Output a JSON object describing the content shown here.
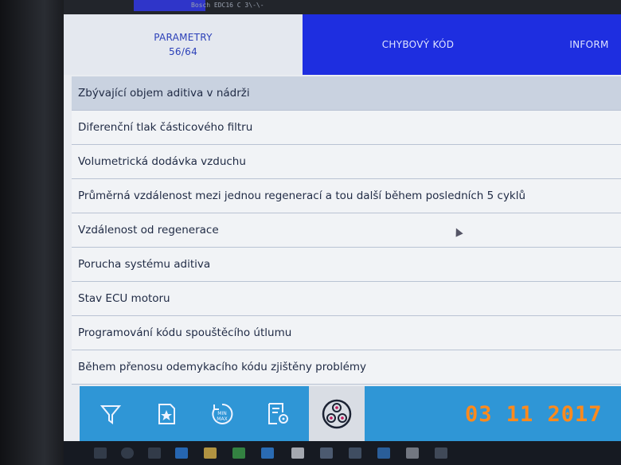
{
  "window": {
    "title": "Bosch EDC16 C 3\\-\\-"
  },
  "tabs": [
    {
      "label": "PARAMETRY",
      "count": "56/64"
    },
    {
      "label": "CHYBOVÝ KÓD"
    },
    {
      "label": "INFORM"
    }
  ],
  "parameters": [
    "Zbývající objem aditiva v nádrži",
    "Diferenční tlak částicového filtru",
    "Volumetrická dodávka vzduchu",
    "Průměrná vzdálenost mezi jednou regenerací a tou další během posledních 5 cyklů",
    "Vzdálenost od regenerace",
    "Porucha systému aditiva",
    "Stav ECU motoru",
    "Programování kódu spouštěcího útlumu",
    "Během přenosu odemykacího kódu zjištěny problémy"
  ],
  "toolbar": {
    "icons": [
      "filter-icon",
      "favorite-page-icon",
      "min-max-icon",
      "settings-list-icon",
      "sensor-icon"
    ],
    "minmax_min": "MIN",
    "minmax_max": "MAX",
    "date_stamp": "03 11 2017"
  },
  "colors": {
    "accent": "#1e2ee0",
    "toolbar": "#2f96d6",
    "date": "#ff8a1c"
  }
}
